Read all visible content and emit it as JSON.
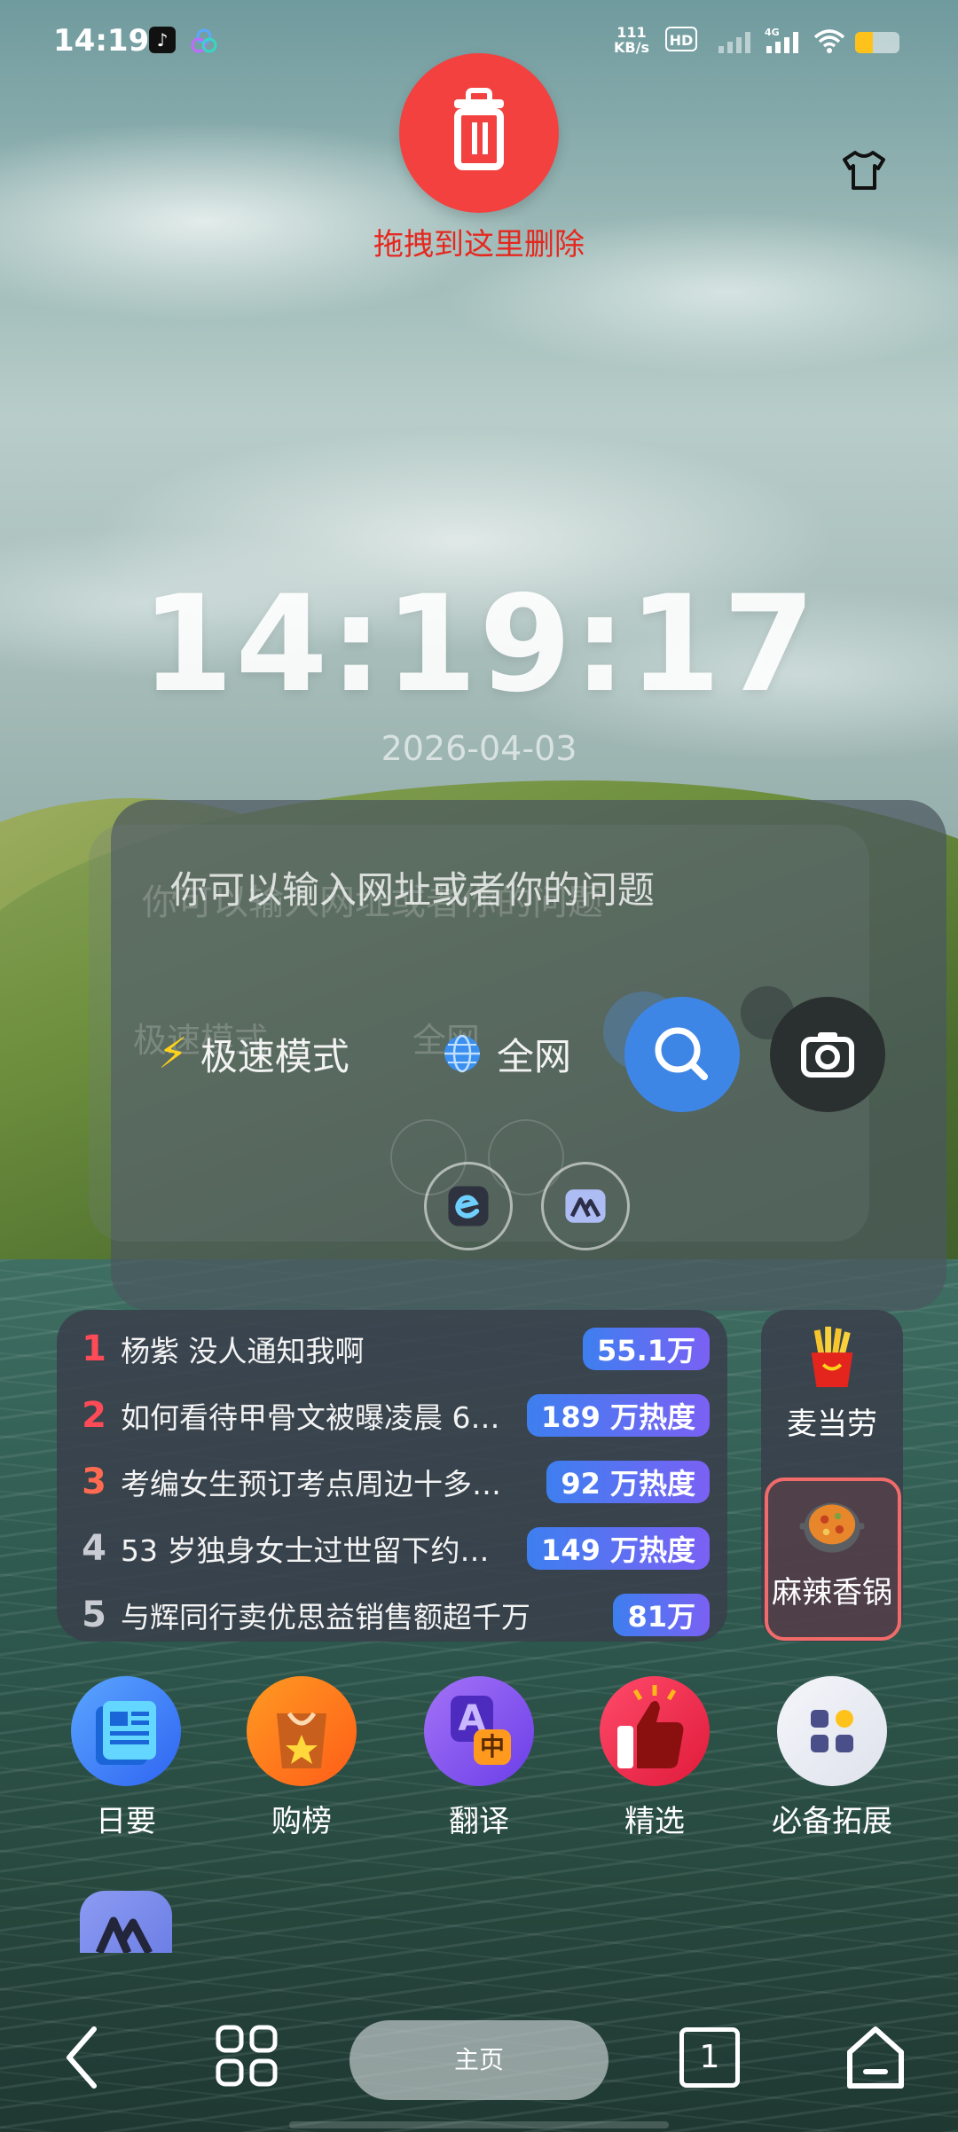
{
  "status_bar": {
    "time": "14:19",
    "net_speed_value": "111",
    "net_speed_unit": "KB/s",
    "hd_label": "HD",
    "network_type": "4G",
    "battery_percent": 40,
    "battery_color": "#ffc21a"
  },
  "delete_zone": {
    "label": "拖拽到这里删除",
    "color": "#f2413f",
    "icon": "trash-icon"
  },
  "clock": {
    "time": "14:19:17",
    "date": "2026-04-03"
  },
  "search": {
    "placeholder": "你可以输入网址或者你的问题",
    "mode_label": "极速模式",
    "scope_label": "全网",
    "ghost_mode_label": "极速模式",
    "ghost_scope_label": "全网",
    "search_icon": "search-icon",
    "camera_icon": "camera-icon",
    "shortcut_icons": [
      "edge-icon",
      "ai-mountain-icon"
    ]
  },
  "hot_list": [
    {
      "rank": "1",
      "title": "杨紫 没人通知我啊",
      "heat": "55.1万",
      "rank_color": "#ff4a57"
    },
    {
      "rank": "2",
      "title": "如何看待甲骨文被曝凌晨 6…",
      "heat": "189 万热度",
      "rank_color": "#ff4a57"
    },
    {
      "rank": "3",
      "title": "考编女生预订考点周边十多…",
      "heat": "92 万热度",
      "rank_color": "#ff6a50"
    },
    {
      "rank": "4",
      "title": "53 岁独身女士过世留下约…",
      "heat": "149 万热度",
      "rank_color": "#c9cbd3"
    },
    {
      "rank": "5",
      "title": "与辉同行卖优思益销售额超千万",
      "heat": "81万",
      "rank_color": "#c9cbd3"
    }
  ],
  "side_items": [
    {
      "label": "麦当劳",
      "icon": "fries-icon"
    },
    {
      "label": "麻辣香锅",
      "icon": "hotpot-icon"
    }
  ],
  "apps": [
    {
      "label": "日要",
      "icon": "news-icon"
    },
    {
      "label": "购榜",
      "icon": "shopping-bag-icon"
    },
    {
      "label": "翻译",
      "icon": "translate-icon"
    },
    {
      "label": "精选",
      "icon": "thumbs-up-icon"
    },
    {
      "label": "必备拓展",
      "icon": "extensions-icon"
    }
  ],
  "translate_badge": "中",
  "translate_letter": "A",
  "bottom_nav": {
    "home_label": "主页",
    "tab_count": "1"
  }
}
